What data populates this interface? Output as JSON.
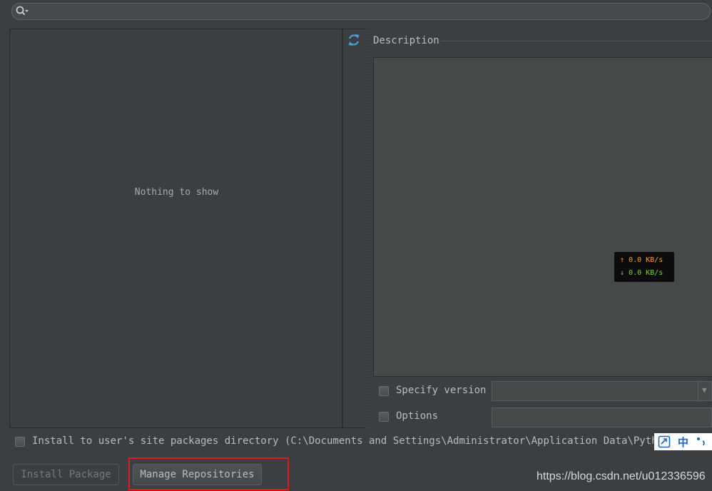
{
  "search": {
    "value": "",
    "icon": "search-icon"
  },
  "package_list": {
    "empty_text": "Nothing to show"
  },
  "toolbar": {
    "refresh_icon": "refresh-icon"
  },
  "description": {
    "title": "Description"
  },
  "net_speed": {
    "up": "0.0 KB/s",
    "down": "0.0 KB/s"
  },
  "options": {
    "specify_version_label": "Specify version",
    "specify_version_value": "",
    "options_label": "Options",
    "options_value": "",
    "user_site_label": "Install to user's site packages directory (C:\\Documents and Settings\\Administrator\\Application Data\\Python)"
  },
  "ime": {
    "zh_label": "中"
  },
  "buttons": {
    "install": "Install Package",
    "manage": "Manage Repositories"
  },
  "watermark": "https://blog.csdn.net/u012336596",
  "colors": {
    "background": "#3c3f41",
    "accent": "#4a9fd8",
    "highlight": "#e0191f"
  }
}
